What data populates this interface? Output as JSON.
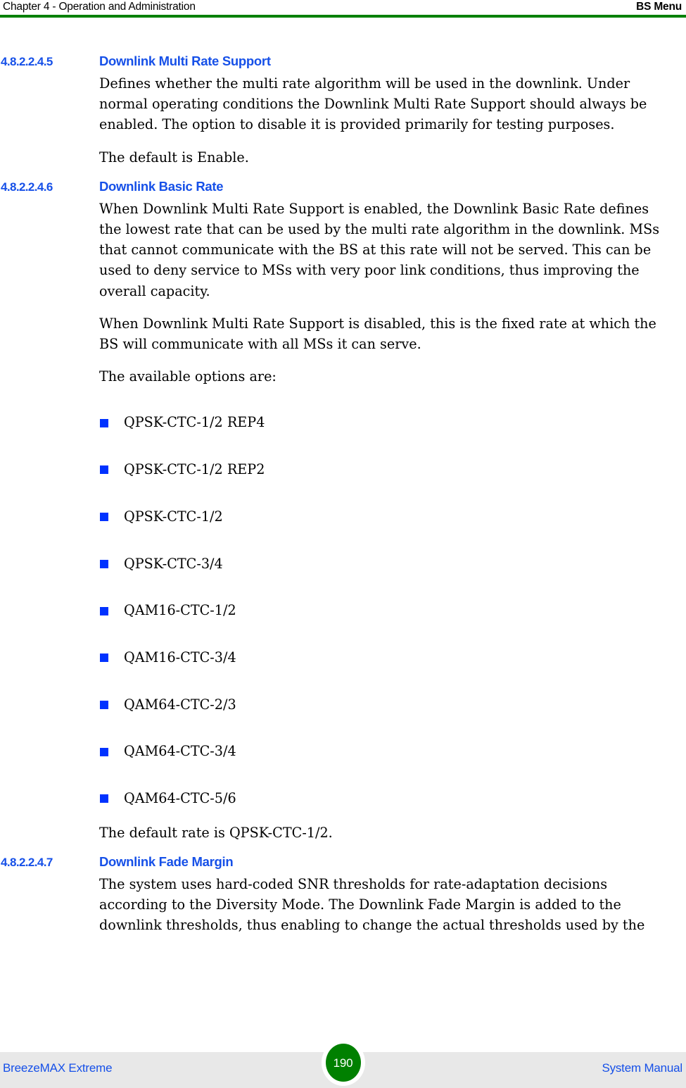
{
  "header": {
    "left": "Chapter 4 - Operation and Administration",
    "right": "BS Menu",
    "rule_color": "#008000"
  },
  "colors": {
    "heading_blue": "#1650e8",
    "bullet_blue": "#0032ff",
    "rule_green": "#008000",
    "footer_bg": "#e8e8e8",
    "badge_green": "#008000",
    "body_text": "#000000"
  },
  "sections": [
    {
      "number": "4.8.2.2.4.5",
      "title": "Downlink Multi Rate Support",
      "paragraphs": [
        "Defines whether the multi rate algorithm will be used in the downlink. Under normal operating conditions the Downlink Multi Rate Support should always be enabled. The option to disable it is provided primarily for testing purposes.",
        "The default is Enable."
      ]
    },
    {
      "number": "4.8.2.2.4.6",
      "title": "Downlink Basic Rate",
      "paragraphs": [
        "When Downlink Multi Rate Support is enabled, the Downlink Basic Rate defines the lowest rate that can be used by the multi rate algorithm in the downlink. MSs that cannot communicate with the BS at this rate will not be served. This can be used to deny service to MSs with very poor link conditions, thus improving the overall capacity.",
        "When Downlink Multi Rate Support is disabled, this is the fixed rate at which the BS will communicate with all MSs it can serve.",
        "The available options are:"
      ],
      "bullets": [
        "QPSK-CTC-1/2 REP4",
        "QPSK-CTC-1/2 REP2",
        "QPSK-CTC-1/2",
        "QPSK-CTC-3/4",
        "QAM16-CTC-1/2",
        "QAM16-CTC-3/4",
        "QAM64-CTC-2/3",
        "QAM64-CTC-3/4",
        "QAM64-CTC-5/6"
      ],
      "closing": "The default rate is QPSK-CTC-1/2."
    },
    {
      "number": "4.8.2.2.4.7",
      "title": "Downlink Fade Margin",
      "paragraphs": [
        "The system uses hard-coded SNR thresholds for rate-adaptation decisions according to the Diversity Mode. The Downlink Fade Margin is added to the downlink thresholds, thus enabling to change the actual thresholds used by the"
      ]
    }
  ],
  "footer": {
    "left": "BreezeMAX Extreme",
    "page_number": "190",
    "right": "System Manual"
  }
}
